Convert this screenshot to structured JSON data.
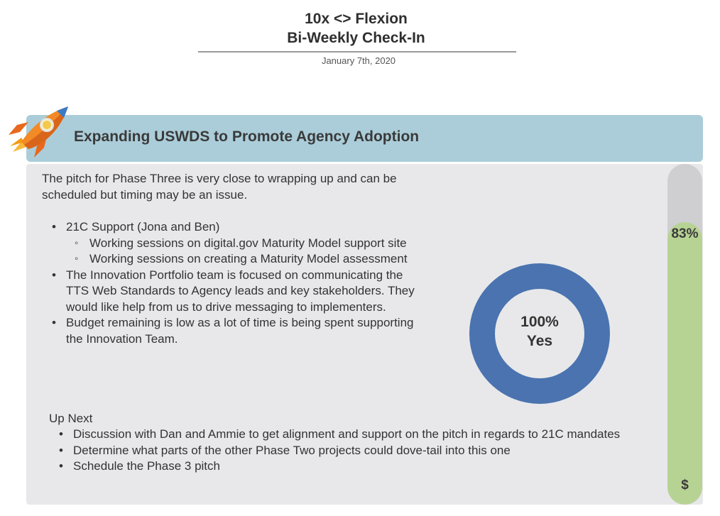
{
  "header": {
    "title_line1": "10x <> Flexion",
    "title_line2": "Bi-Weekly Check-In",
    "date": "January 7th, 2020"
  },
  "banner": {
    "title": "Expanding USWDS to Promote Agency Adoption",
    "icon": "rocket-icon"
  },
  "content": {
    "intro": "The pitch for Phase Three is very close to wrapping up and can be scheduled but timing may be an issue.",
    "bullets": [
      {
        "text": "21C Support (Jona and Ben)",
        "sub": [
          "Working sessions on digital.gov Maturity Model support site",
          "Working sessions on creating a Maturity Model assessment"
        ]
      },
      {
        "text": "The Innovation Portfolio team is focused on communicating the TTS Web Standards to Agency leads and key stakeholders. They would like help from us to drive messaging to implementers."
      },
      {
        "text": "Budget remaining is low as a lot of time is being spent supporting the Innovation Team."
      }
    ],
    "up_next": {
      "title": "Up Next",
      "items": [
        "Discussion with Dan and Ammie to get alignment and support on the pitch in regards to 21C mandates",
        "Determine what parts of the other Phase Two projects could dove-tail into this one",
        "Schedule the Phase 3 pitch"
      ]
    }
  },
  "donut": {
    "value_label": "100%",
    "answer_label": "Yes",
    "value_fraction": 1.0,
    "color": "#4a73b0"
  },
  "budget": {
    "percent_label": "83%",
    "fill_fraction": 0.83,
    "symbol": "$",
    "fill_color": "#b7d394",
    "track_color": "#cfcfd1"
  }
}
